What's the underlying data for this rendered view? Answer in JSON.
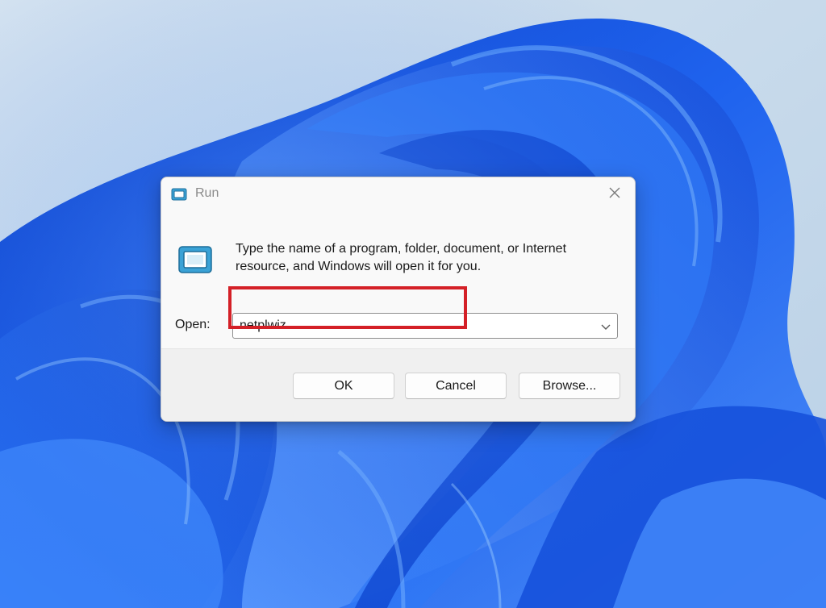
{
  "dialog": {
    "title": "Run",
    "description": "Type the name of a program, folder, document, or Internet resource, and Windows will open it for you.",
    "open_label": "Open:",
    "open_value": "netplwiz",
    "ok_label": "OK",
    "cancel_label": "Cancel",
    "browse_label": "Browse..."
  },
  "icons": {
    "title": "run-app-icon",
    "main": "run-app-icon",
    "close": "close-icon",
    "dropdown": "chevron-down-icon"
  },
  "colors": {
    "highlight": "#d42027",
    "wallpaper_base": "#1e5fe0",
    "wallpaper_sky": "#c9dcec"
  }
}
